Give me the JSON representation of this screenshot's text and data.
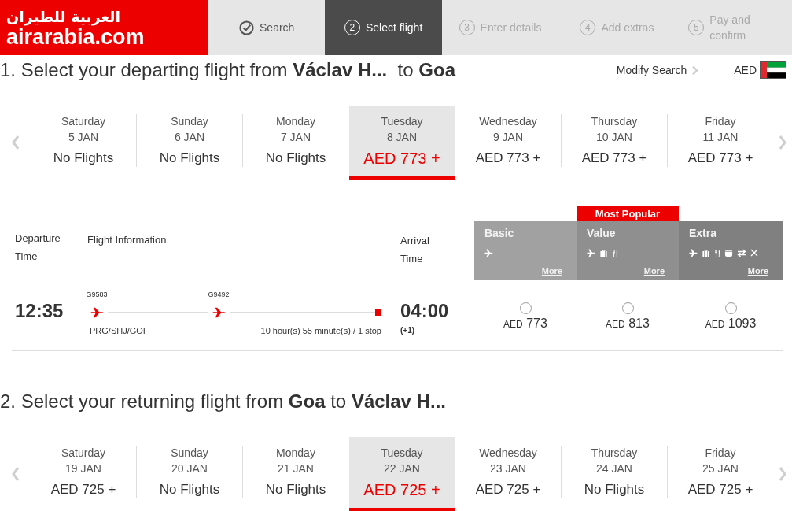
{
  "logo": {
    "arabic": "العربية للطيران",
    "wordmark": "airarabia.com"
  },
  "steps": [
    {
      "completed": true,
      "selected": false,
      "label": "Search"
    },
    {
      "completed": false,
      "selected": true,
      "number": "2",
      "label": "Select flight"
    },
    {
      "completed": false,
      "selected": false,
      "number": "3",
      "label": "Enter details"
    },
    {
      "completed": false,
      "selected": false,
      "number": "4",
      "label": "Add extras"
    },
    {
      "completed": false,
      "selected": false,
      "number": "5",
      "label": "Pay and confirm"
    }
  ],
  "departing": {
    "title": "1. Select your departing flight from **Václav H...**  to **Goa**",
    "modify_search": "Modify Search",
    "currency": "AED",
    "dates": [
      {
        "day": "Saturday",
        "date": "5 JAN",
        "price": "No Flights",
        "selected": false
      },
      {
        "day": "Sunday",
        "date": "6 JAN",
        "price": "No Flights",
        "selected": false
      },
      {
        "day": "Monday",
        "date": "7 JAN",
        "price": "No Flights",
        "selected": false
      },
      {
        "day": "Tuesday",
        "date": "8 JAN",
        "price": "AED 773 +",
        "selected": true
      },
      {
        "day": "Wednesday",
        "date": "9 JAN",
        "price": "AED 773 +",
        "selected": false
      },
      {
        "day": "Thursday",
        "date": "10 JAN",
        "price": "AED 773 +",
        "selected": false
      },
      {
        "day": "Friday",
        "date": "11 JAN",
        "price": "AED 773 +",
        "selected": false
      }
    ],
    "table": {
      "columns": {
        "departure": "Departure Time",
        "flight_info": "Flight Information",
        "arrival": "Arrival Time"
      },
      "fares": [
        {
          "name": "Basic",
          "color": "#a1a1a1",
          "features": [
            {
              "kind": "flight"
            }
          ],
          "more": "More"
        },
        {
          "name": "Value",
          "badge": "Most Popular",
          "color": "#8f8f8f",
          "features": [
            {
              "kind": "flight"
            },
            {
              "kind": "baggage"
            },
            {
              "kind": "meal"
            }
          ],
          "more": "More"
        },
        {
          "name": "Extra",
          "color": "#808080",
          "features": [
            {
              "kind": "flight"
            },
            {
              "kind": "baggage"
            },
            {
              "kind": "meal"
            },
            {
              "kind": "seat"
            },
            {
              "kind": "change"
            },
            {
              "kind": "cancel"
            }
          ],
          "more": "More"
        }
      ],
      "flights": [
        {
          "departure": "12:35",
          "legs": [
            {
              "flight_number": "G9583"
            },
            {
              "flight_number": "G9492"
            }
          ],
          "route": "PRG/SHJ/GOI",
          "duration": "10 hour(s) 55 minute(s) / 1 stop",
          "arrival": "04:00",
          "day_offset": "(+1)",
          "prices": [
            {
              "currency": "AED",
              "amount": "773",
              "selected": false
            },
            {
              "currency": "AED",
              "amount": "813",
              "selected": false
            },
            {
              "currency": "AED",
              "amount": "1093",
              "selected": false
            }
          ]
        }
      ]
    }
  },
  "returning": {
    "title": "2. Select your returning flight from **Goa** to **Václav H...**",
    "dates": [
      {
        "day": "Saturday",
        "date": "19 JAN",
        "price": "AED 725 +",
        "selected": false
      },
      {
        "day": "Sunday",
        "date": "20 JAN",
        "price": "No Flights",
        "selected": false
      },
      {
        "day": "Monday",
        "date": "21 JAN",
        "price": "No Flights",
        "selected": false
      },
      {
        "day": "Tuesday",
        "date": "22 JAN",
        "price": "AED 725 +",
        "selected": true
      },
      {
        "day": "Wednesday",
        "date": "23 JAN",
        "price": "AED 725 +",
        "selected": false
      },
      {
        "day": "Thursday",
        "date": "24 JAN",
        "price": "No Flights",
        "selected": false
      },
      {
        "day": "Friday",
        "date": "25 JAN",
        "price": "AED 725 +",
        "selected": false
      }
    ]
  }
}
